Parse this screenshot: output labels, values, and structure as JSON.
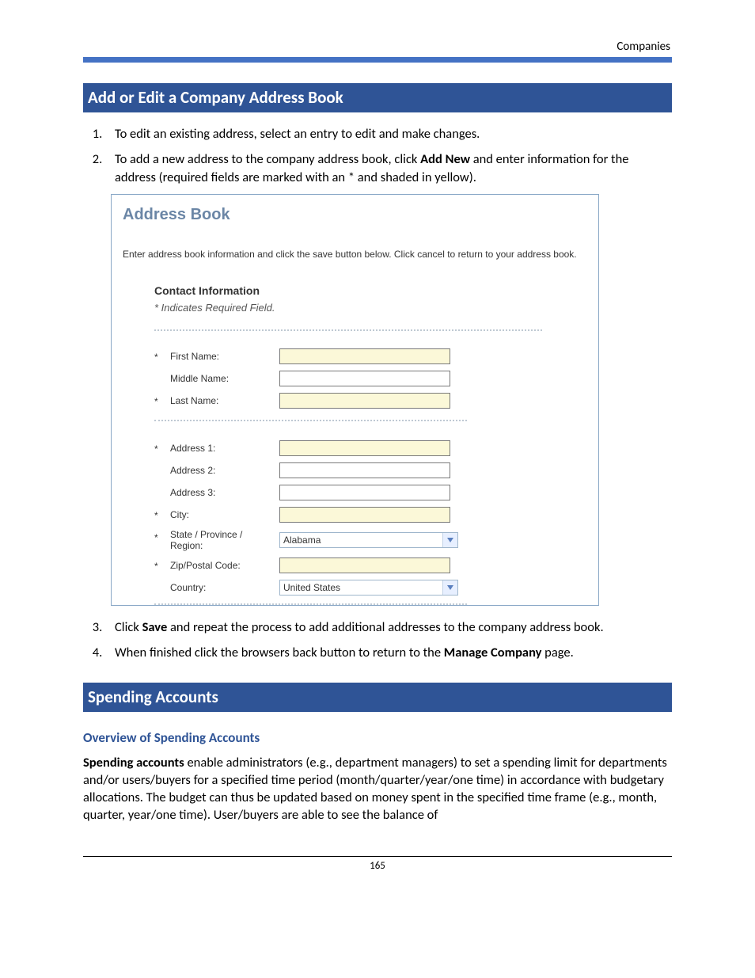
{
  "header": {
    "right": "Companies"
  },
  "h1": "Add or Edit a Company Address Book",
  "steps": {
    "s1": "To edit an existing address, select an entry to edit and make changes.",
    "s2a": "To add a new address to the company address book, click ",
    "s2b": "Add New",
    "s2c": " and enter information for the address (required fields are marked with an * and shaded in yellow).",
    "s3a": "Click ",
    "s3b": "Save",
    "s3c": " and repeat the process to add additional addresses to the company address book.",
    "s4a": "When finished click the browsers back button to return to the ",
    "s4b": "Manage Company",
    "s4c": " page."
  },
  "ab": {
    "title": "Address Book",
    "instr": "Enter address book information and click the save button below. Click cancel to return to your address book.",
    "sectionTitle": "Contact Information",
    "requiredNote": "* Indicates Required Field.",
    "labels": {
      "first": "First Name:",
      "middle": "Middle Name:",
      "last": "Last Name:",
      "addr1": "Address 1:",
      "addr2": "Address 2:",
      "addr3": "Address 3:",
      "city": "City:",
      "state": "State / Province / Region:",
      "zip": "Zip/Postal Code:",
      "country": "Country:"
    },
    "values": {
      "state": "Alabama",
      "country": "United States"
    },
    "star": "*"
  },
  "h2": "Spending Accounts",
  "sub": "Overview of Spending Accounts",
  "para": {
    "p1a": "Spending accounts",
    "p1b": " enable administrators (e.g., department managers) to set a spending limit for departments and/or users/buyers for a specified time period (month/quarter/year/one time) in accordance with budgetary allocations. The budget can thus be updated based on money spent in the specified time frame (e.g., month, quarter, year/one time). User/buyers are able to see the balance of"
  },
  "pageNumber": "165"
}
